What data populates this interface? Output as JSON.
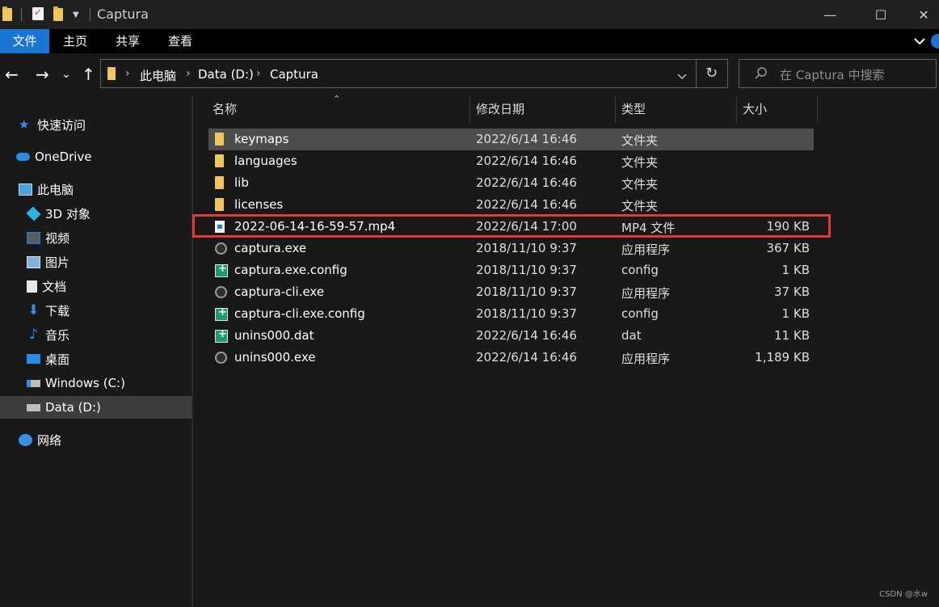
{
  "window": {
    "title": "Captura",
    "quick_access": [
      "folder-icon",
      "properties-icon",
      "new-folder-icon",
      "customize-dropdown-icon"
    ],
    "controls": {
      "minimize": "—",
      "maximize": "☐",
      "close": "✕"
    }
  },
  "ribbon": {
    "tabs": [
      {
        "label": "文件",
        "active": true
      },
      {
        "label": "主页",
        "active": false
      },
      {
        "label": "共享",
        "active": false
      },
      {
        "label": "查看",
        "active": false
      }
    ],
    "expand_icon": "chevron-down-icon",
    "help_icon": "help-icon"
  },
  "toolbar": {
    "back": "←",
    "forward": "→",
    "recent": "⌄",
    "up": "↑",
    "breadcrumb": [
      "此电脑",
      "Data (D:)",
      "Captura"
    ],
    "refresh": "↻",
    "search_placeholder": "在 Captura 中搜索"
  },
  "navigation": {
    "items": [
      {
        "label": "快速访问",
        "icon": "star-icon"
      },
      {
        "label": "OneDrive",
        "icon": "cloud-icon"
      },
      {
        "label": "此电脑",
        "icon": "computer-icon"
      },
      {
        "label": "3D 对象",
        "icon": "3d-objects-icon"
      },
      {
        "label": "视频",
        "icon": "videos-icon"
      },
      {
        "label": "图片",
        "icon": "pictures-icon"
      },
      {
        "label": "文档",
        "icon": "documents-icon"
      },
      {
        "label": "下载",
        "icon": "download-icon"
      },
      {
        "label": "音乐",
        "icon": "music-icon"
      },
      {
        "label": "桌面",
        "icon": "desktop-icon"
      },
      {
        "label": "Windows (C:)",
        "icon": "drive-icon"
      },
      {
        "label": "Data (D:)",
        "icon": "drive-icon",
        "selected": true
      },
      {
        "label": "网络",
        "icon": "network-icon"
      }
    ]
  },
  "file_list": {
    "columns": {
      "name": "名称",
      "date": "修改日期",
      "type": "类型",
      "size": "大小"
    },
    "files": [
      {
        "name": "keymaps",
        "date": "2022/6/14 16:46",
        "type": "文件夹",
        "size": "",
        "icon": "folder-icon",
        "selected": true
      },
      {
        "name": "languages",
        "date": "2022/6/14 16:46",
        "type": "文件夹",
        "size": "",
        "icon": "folder-icon"
      },
      {
        "name": "lib",
        "date": "2022/6/14 16:46",
        "type": "文件夹",
        "size": "",
        "icon": "folder-icon"
      },
      {
        "name": "licenses",
        "date": "2022/6/14 16:46",
        "type": "文件夹",
        "size": "",
        "icon": "folder-icon"
      },
      {
        "name": "2022-06-14-16-59-57.mp4",
        "date": "2022/6/14 17:00",
        "type": "MP4 文件",
        "size": "190 KB",
        "icon": "video-file-icon",
        "highlighted": true
      },
      {
        "name": "captura.exe",
        "date": "2018/11/10 9:37",
        "type": "应用程序",
        "size": "367 KB",
        "icon": "app-icon"
      },
      {
        "name": "captura.exe.config",
        "date": "2018/11/10 9:37",
        "type": "config",
        "size": "1 KB",
        "icon": "config-file-icon"
      },
      {
        "name": "captura-cli.exe",
        "date": "2018/11/10 9:37",
        "type": "应用程序",
        "size": "37 KB",
        "icon": "app-icon"
      },
      {
        "name": "captura-cli.exe.config",
        "date": "2018/11/10 9:37",
        "type": "config",
        "size": "1 KB",
        "icon": "config-file-icon"
      },
      {
        "name": "unins000.dat",
        "date": "2022/6/14 16:46",
        "type": "dat",
        "size": "11 KB",
        "icon": "config-file-icon"
      },
      {
        "name": "unins000.exe",
        "date": "2022/6/14 16:46",
        "type": "应用程序",
        "size": "1,189 KB",
        "icon": "app-icon"
      }
    ]
  },
  "annotation": {
    "color": "#e53935"
  },
  "watermark": "CSDN @水w",
  "colors": {
    "accent": "#1976d2",
    "folder": "#f2c55c",
    "background": "#191919"
  }
}
